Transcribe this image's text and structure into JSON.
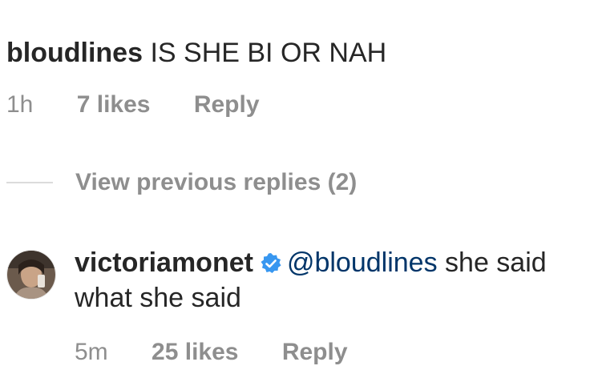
{
  "parent_comment": {
    "username": "bloudlines",
    "text": "IS SHE BI OR NAH",
    "time": "1h",
    "likes": "7 likes",
    "reply_label": "Reply"
  },
  "view_previous": {
    "label": "View previous replies (2)"
  },
  "reply_comment": {
    "username": "victoriamonet",
    "verified_icon": "verified-badge-icon",
    "mention": "@bloudlines",
    "text": " she said what she said",
    "time": "5m",
    "likes": "25 likes",
    "reply_label": "Reply"
  },
  "colors": {
    "text": "#262626",
    "meta": "#8e8e8e",
    "mention": "#003569",
    "verified": "#3897f0",
    "divider": "#dbdbdb"
  }
}
